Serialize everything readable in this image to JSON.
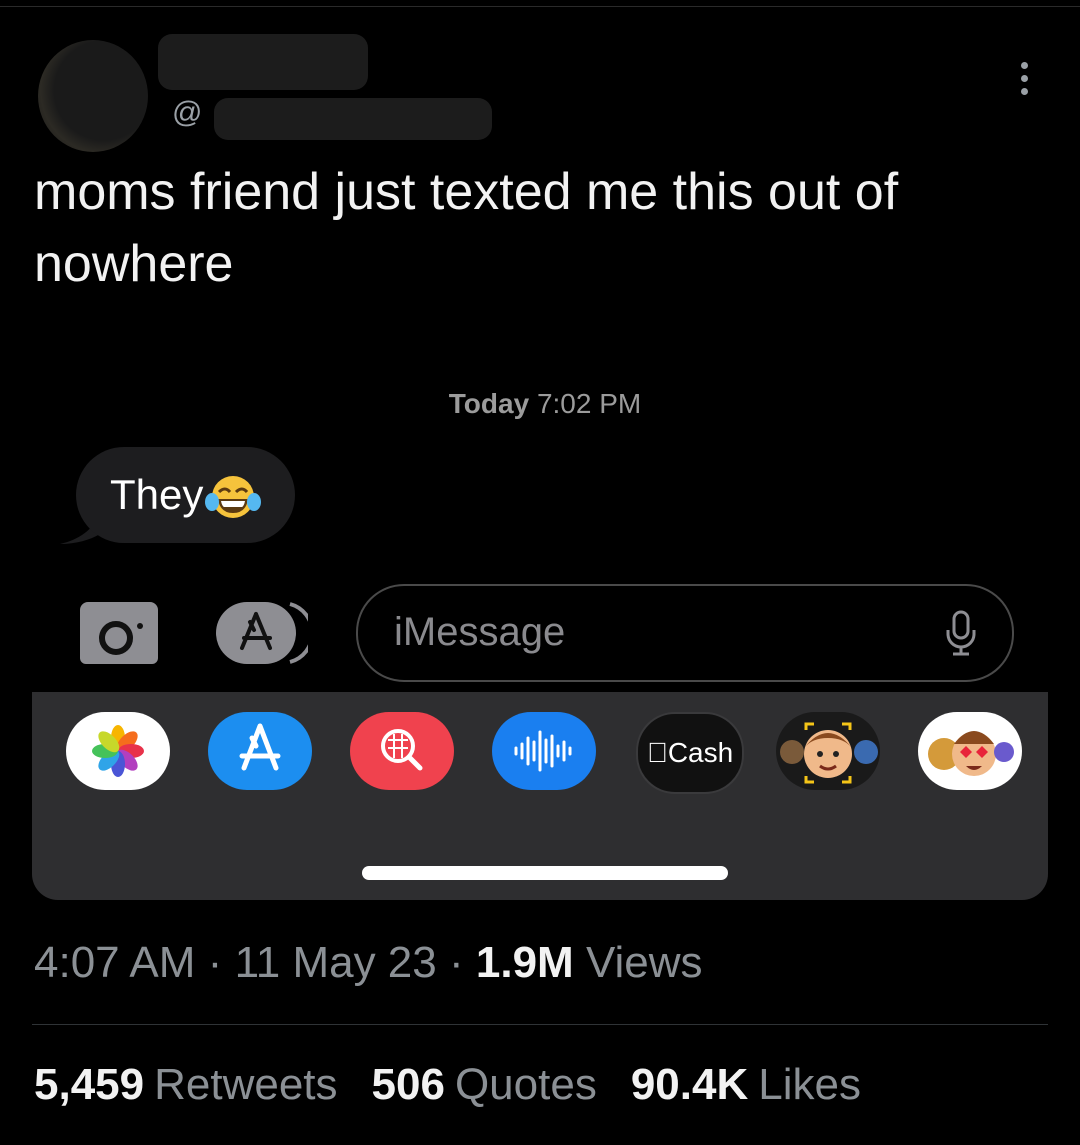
{
  "tweet": {
    "handle_prefix": "@",
    "text": "moms friend just texted me this out of nowhere",
    "timestamp": "4:07 AM",
    "date": "11 May 23",
    "separator": "·",
    "views_count": "1.9M",
    "views_label": "Views"
  },
  "stats": {
    "retweets_count": "5,459",
    "retweets_label": "Retweets",
    "quotes_count": "506",
    "quotes_label": "Quotes",
    "likes_count": "90.4K",
    "likes_label": "Likes"
  },
  "imessage": {
    "time_day": "Today",
    "time_clock": "7:02 PM",
    "bubble_text": "They",
    "bubble_emoji": "face-with-tears-of-joy",
    "input_placeholder": "iMessage",
    "cash_label": "Cash"
  },
  "icons": {
    "more": "more-vertical-icon",
    "camera": "camera-icon",
    "apps": "app-store-icon",
    "mic": "microphone-icon",
    "drawer_apps": [
      "photos-icon",
      "app-store-icon",
      "image-search-icon",
      "audio-message-icon",
      "apple-cash-icon",
      "memoji-icon",
      "memoji-stickers-icon"
    ]
  },
  "colors": {
    "background": "#000000",
    "bubble": "#1d1d1f",
    "drawer": "#2e2e30",
    "app_store_blue": "#1c8ef0",
    "search_red": "#f0424e",
    "audio_blue": "#1a7ff0"
  }
}
